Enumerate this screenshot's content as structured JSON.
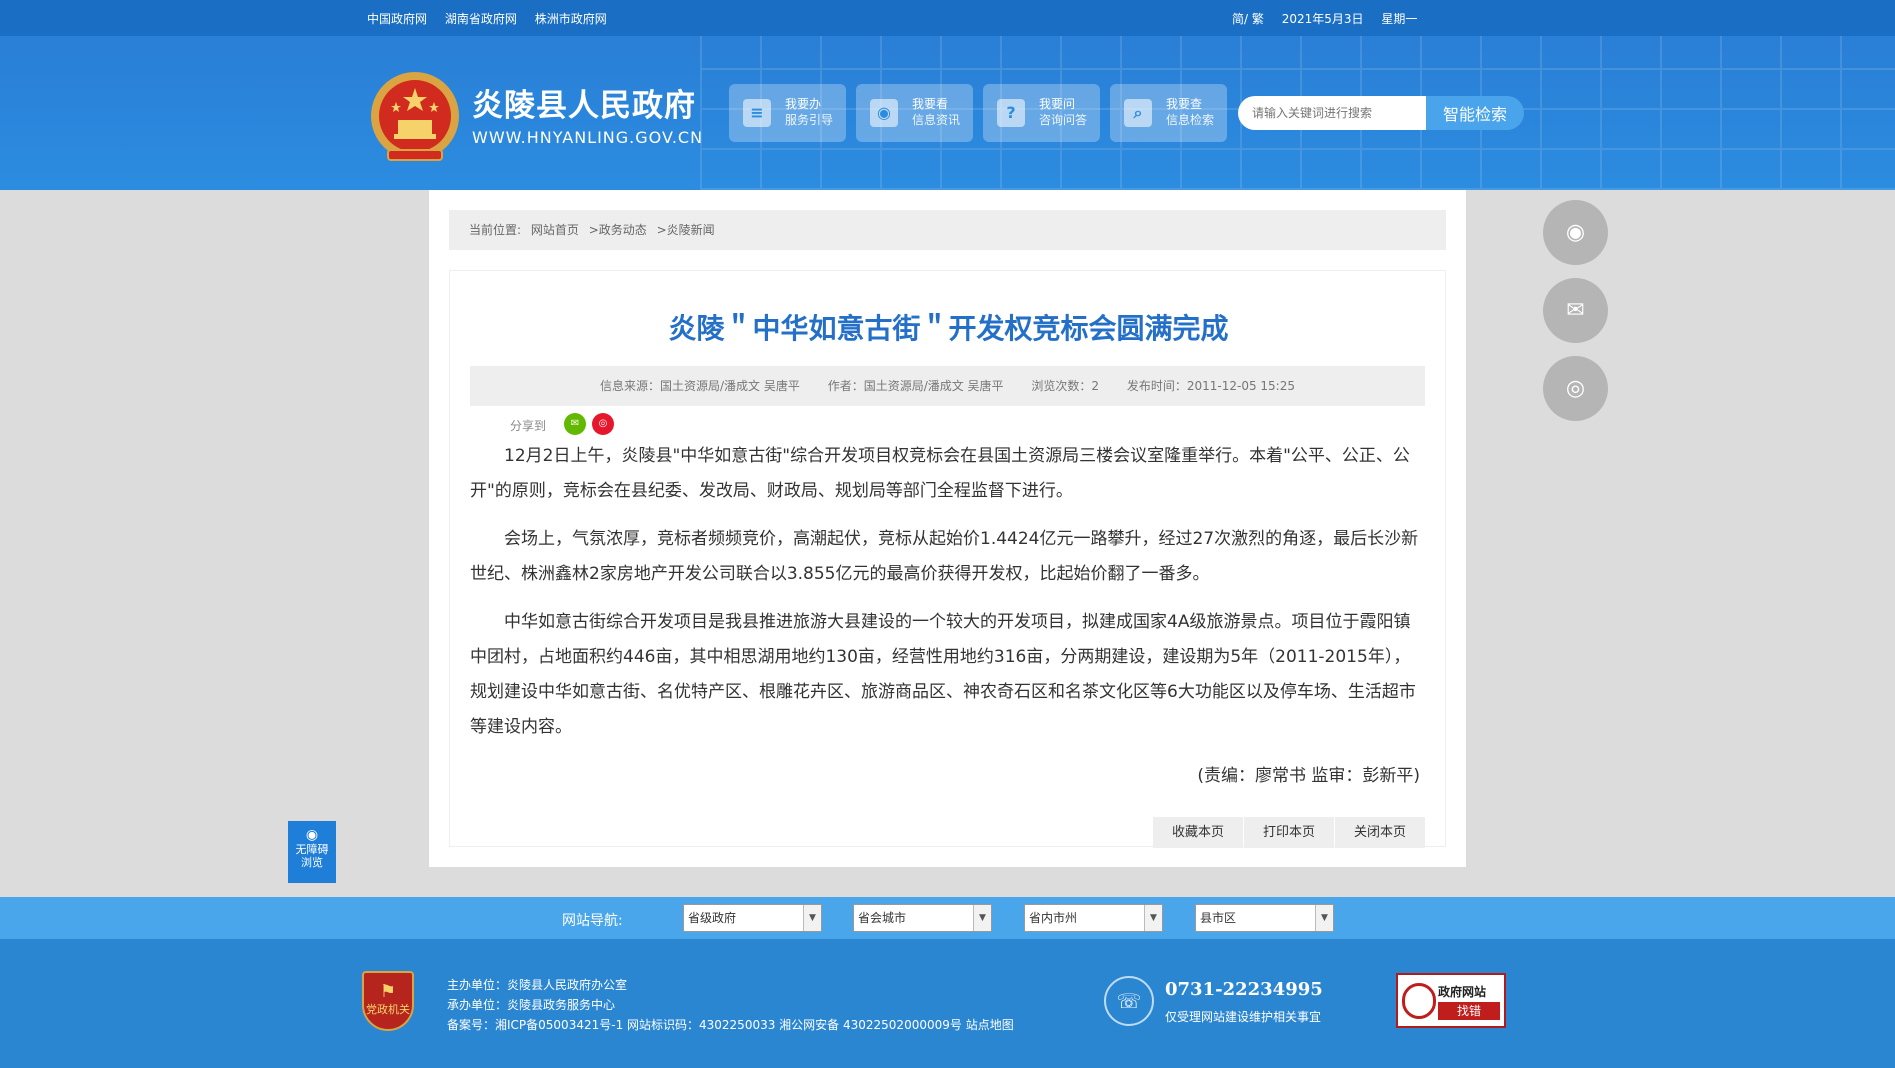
{
  "topbar": {
    "links": [
      "中国政府网",
      "湖南省政府网",
      "株洲市政府网"
    ],
    "lang": "简/ 繁",
    "date": "2021年5月3日",
    "weekday": "星期一"
  },
  "header": {
    "title": "炎陵县人民政府",
    "url": "WWW.HNYANLING.GOV.CN",
    "nav": [
      {
        "line1": "我要办",
        "line2": "服务引导",
        "icon": "document-icon"
      },
      {
        "line1": "我要看",
        "line2": "信息资讯",
        "icon": "eye-icon"
      },
      {
        "line1": "我要问",
        "line2": "咨询问答",
        "icon": "question-icon"
      },
      {
        "line1": "我要查",
        "line2": "信息检索",
        "icon": "search-icon"
      }
    ],
    "search_placeholder": "请输入关键词进行搜索",
    "search_button": "智能检索"
  },
  "breadcrumb": {
    "label": "当前位置:",
    "items": [
      "网站首页",
      ">政务动态",
      ">炎陵新闻"
    ]
  },
  "article": {
    "title": "炎陵＂中华如意古街＂开发权竞标会圆满完成",
    "meta": {
      "source": "信息来源：国土资源局/潘成文 吴唐平",
      "author": "作者：国土资源局/潘成文 吴唐平",
      "views": "浏览次数：2",
      "published": "发布时间：2011-12-05 15:25"
    },
    "share_label": "分享到",
    "paragraphs": [
      "12月2日上午，炎陵县\"中华如意古街\"综合开发项目权竞标会在县国土资源局三楼会议室隆重举行。本着\"公平、公正、公开\"的原则，竞标会在县纪委、发改局、财政局、规划局等部门全程监督下进行。",
      "会场上，气氛浓厚，竞标者频频竞价，高潮起伏，竞标从起始价1.4424亿元一路攀升，经过27次激烈的角逐，最后长沙新世纪、株洲鑫林2家房地产开发公司联合以3.855亿元的最高价获得开发权，比起始价翻了一番多。",
      "中华如意古街综合开发项目是我县推进旅游大县建设的一个较大的开发项目，拟建成国家4A级旅游景点。项目位于霞阳镇中团村，占地面积约446亩，其中相思湖用地约130亩，经营性用地约316亩，分两期建设，建设期为5年（2011-2015年），规划建设中华如意古街、名优特产区、根雕花卉区、旅游商品区、神农奇石区和名茶文化区等6大功能区以及停车场、生活超市等建设内容。"
    ],
    "editor": "(责编：廖常书  监审：彭新平)",
    "actions": [
      "收藏本页",
      "打印本页",
      "关闭本页"
    ]
  },
  "accessibility": {
    "line1": "无障碍",
    "line2": "浏览"
  },
  "site_nav": {
    "label": "网站导航:",
    "selects": [
      "省级政府",
      "省会城市",
      "省内市州",
      "县市区"
    ]
  },
  "footer": {
    "badge": "党政机关",
    "host": "主办单位：炎陵县人民政府办公室",
    "organizer": "承办单位：炎陵县政务服务中心",
    "record": "备案号：湘ICP备05003421号-1 网站标识码：4302250033 湘公网安备 43022502000009号 站点地图",
    "phone": "0731-22234995",
    "phone_note": "仅受理网站建设维护相关事宜",
    "jiucuo_line1": "政府网站",
    "jiucuo_line2": "找错"
  }
}
